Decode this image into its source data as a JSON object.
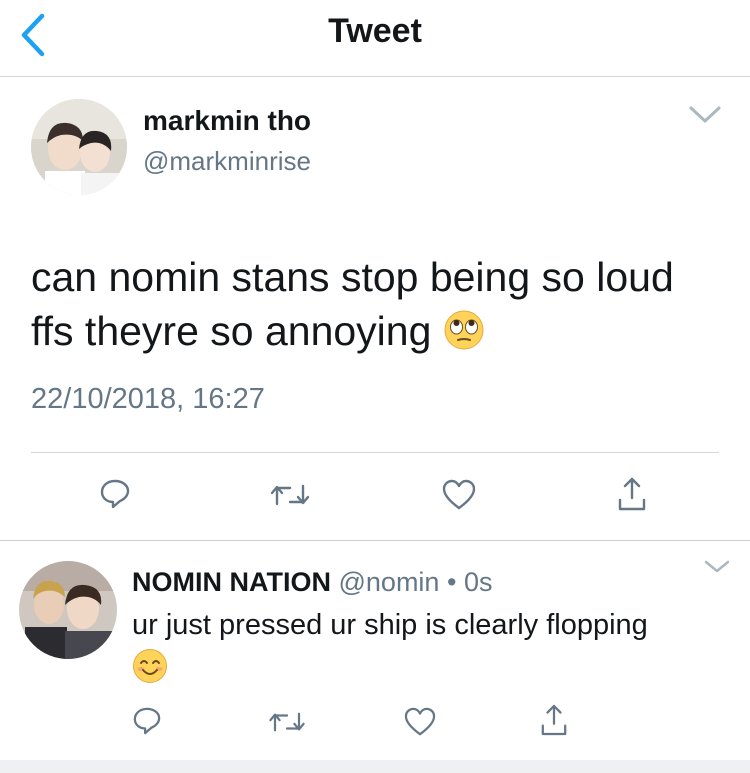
{
  "header": {
    "title": "Tweet",
    "back_icon": "chevron-left-icon"
  },
  "colors": {
    "accent": "#1da1f2",
    "text": "#14171a",
    "secondary": "#657786",
    "emoji_face": "#fdd35a"
  },
  "tweet": {
    "author_name": "markmin tho",
    "author_handle": "@markminrise",
    "text_line1": "can nomin stans stop being so loud",
    "text_line2": "ffs theyre so annoying",
    "emoji": "face-with-rolling-eyes",
    "timestamp": "22/10/2018, 16:27",
    "actions": [
      "reply-icon",
      "retweet-icon",
      "like-icon",
      "share-icon"
    ]
  },
  "reply": {
    "author_name": "NOMIN NATION",
    "author_handle": "@nomin",
    "separator": "•",
    "time": "0s",
    "text": "ur just pressed ur ship is clearly flopping",
    "emoji": "smiling-face-with-smiling-eyes",
    "actions": [
      "reply-icon",
      "retweet-icon",
      "like-icon",
      "share-icon"
    ]
  }
}
